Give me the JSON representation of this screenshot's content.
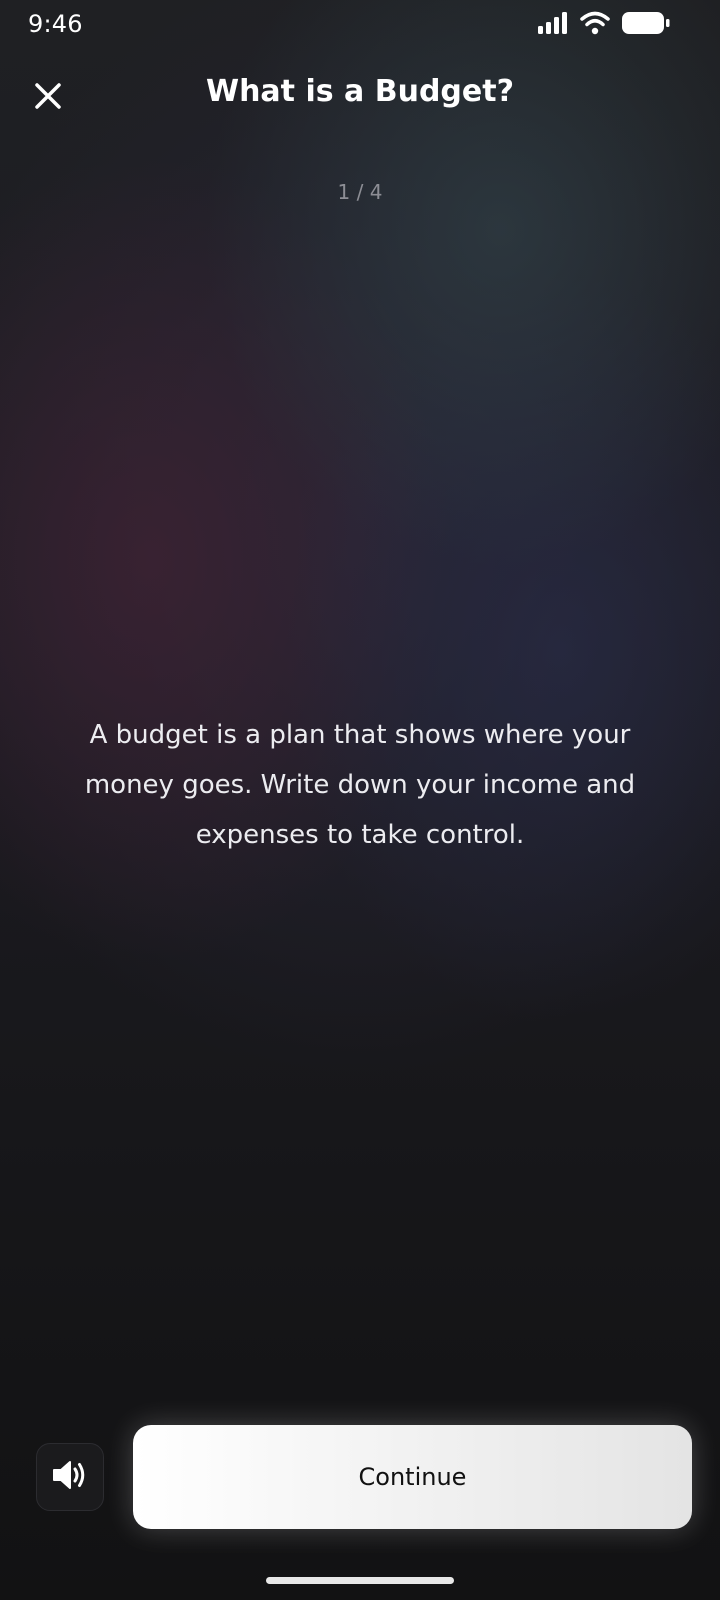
{
  "status_bar": {
    "time": "9:46",
    "icons": [
      "cellular-signal-icon",
      "wifi-icon",
      "battery-icon"
    ]
  },
  "header": {
    "close_icon": "close-icon",
    "title": "What is a Budget?"
  },
  "progress": {
    "label": "1 / 4",
    "current": 1,
    "total": 4
  },
  "content": {
    "text": "A budget is a plan that shows where your money goes. Write down your income and expenses to take control."
  },
  "footer": {
    "sound_icon": "speaker-icon",
    "continue_label": "Continue"
  },
  "colors": {
    "background": "#141416",
    "progress_text": "#8d8e95",
    "button_background": "#f3f3f3",
    "button_text": "#111111"
  }
}
